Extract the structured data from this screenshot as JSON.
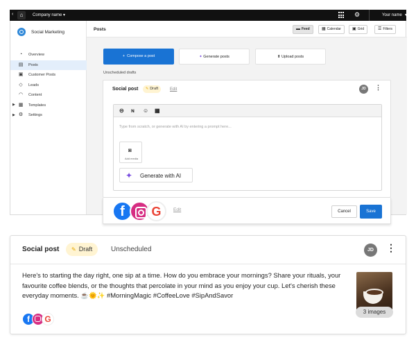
{
  "topbar": {
    "company": "Company name",
    "user": "Your name",
    "icons": [
      "back-icon",
      "home-icon",
      "apps-grid-icon",
      "gear-icon",
      "chevron-down-icon"
    ]
  },
  "sidebar": {
    "brand": "Social Marketing",
    "items": [
      {
        "label": "Overview",
        "icon": "overview-icon"
      },
      {
        "label": "Posts",
        "icon": "posts-icon",
        "active": true
      },
      {
        "label": "Customer Posts",
        "icon": "customer-posts-icon"
      },
      {
        "label": "Leads",
        "icon": "leads-icon"
      },
      {
        "label": "Content",
        "icon": "content-rss-icon"
      },
      {
        "label": "Templates",
        "icon": "templates-icon",
        "expandable": true
      },
      {
        "label": "Settings",
        "icon": "settings-icon",
        "expandable": true
      }
    ]
  },
  "header": {
    "title": "Posts",
    "views": [
      {
        "label": "Feed",
        "icon": "feed-icon",
        "selected": true
      },
      {
        "label": "Calendar",
        "icon": "calendar-icon"
      },
      {
        "label": "Grid",
        "icon": "grid-icon"
      },
      {
        "label": "Filters",
        "icon": "filter-icon"
      }
    ]
  },
  "actions": {
    "compose": "Compose a post",
    "generate": "Generate posts",
    "upload": "Upload posts"
  },
  "section_label": "Unscheduled drafts",
  "composer": {
    "title": "Social post",
    "badge": "Draft",
    "edit": "Edit",
    "avatar": "JD",
    "placeholder": "Type from scratch, or generate with AI by entering a prompt here...",
    "add_media": "Add media",
    "generate_ai": "Generate with AI",
    "footer_edit": "Edit",
    "cancel": "Cancel",
    "save": "Save",
    "toolbar_icons": [
      "link-icon",
      "rss-icon",
      "emoji-icon",
      "template-icon"
    ],
    "networks": [
      "facebook",
      "instagram",
      "google"
    ]
  },
  "post": {
    "title": "Social post",
    "badge": "Draft",
    "status": "Unscheduled",
    "avatar": "JD",
    "body": "Here's to starting the day right, one sip at a time. How do you embrace your mornings? Share your rituals, your favourite coffee blends, or the thoughts that percolate in your mind as you enjoy your cup. Let's cherish these everyday moments. ☕🌞✨ #MorningMagic #CoffeeLove #SipAndSavor",
    "image_count": "3 images",
    "networks": [
      "facebook",
      "instagram",
      "google"
    ]
  },
  "colors": {
    "primary": "#1973d4",
    "draft_badge": "#fff4d2",
    "active_nav": "#e3eefb",
    "topbar": "#111111"
  }
}
